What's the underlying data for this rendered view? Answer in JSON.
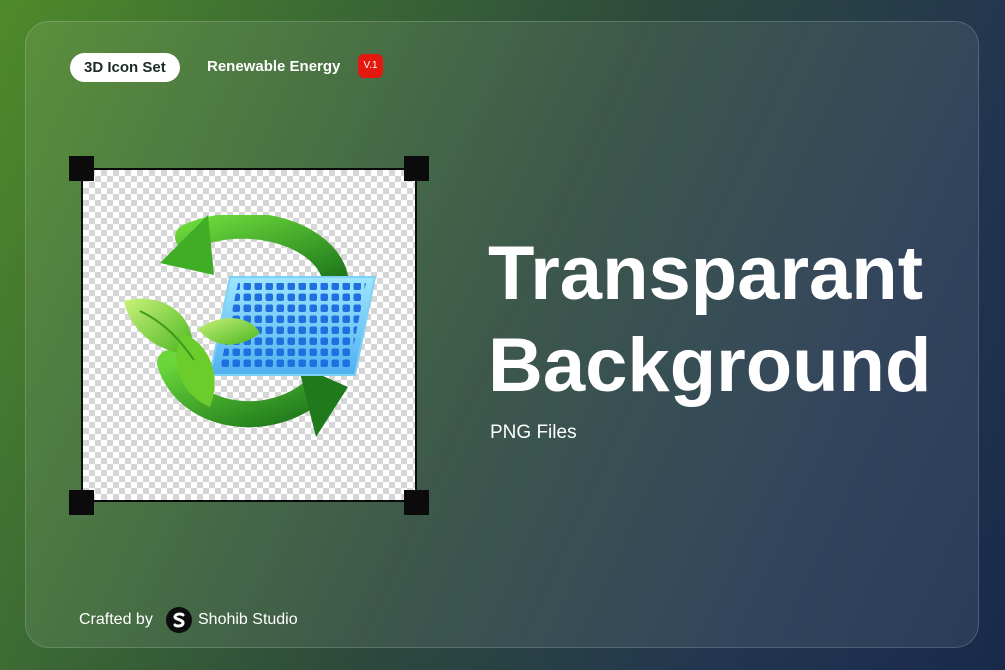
{
  "badge": {
    "label": "3D Icon Set"
  },
  "series": {
    "name": "Renewable Energy",
    "version": "V.1"
  },
  "hero": {
    "title_line1": "Transparant",
    "title_line2": "Background",
    "subtitle": "PNG Files"
  },
  "preview": {
    "icon": "renewable-energy-solar-recycle-icon"
  },
  "footer": {
    "crafted_label": "Crafted by",
    "studio_name": "Shohib Studio"
  },
  "colors": {
    "accent_red": "#e5180f",
    "leaf_green": "#5fc42a",
    "arrow_green": "#2f9a24",
    "solar_blue": "#3f8ff0",
    "bg_start": "#4f8a2a",
    "bg_end": "#182a4a"
  }
}
